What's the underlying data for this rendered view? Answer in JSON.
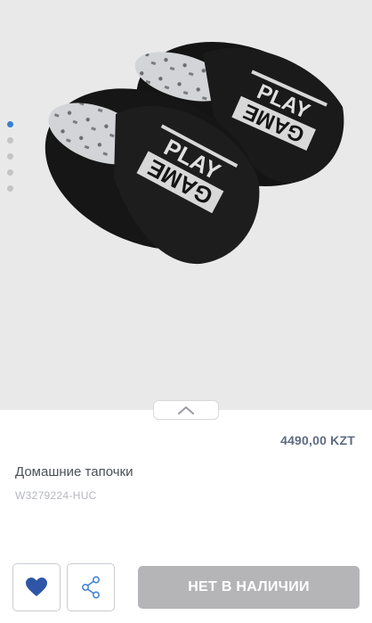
{
  "gallery": {
    "image_label": "Домашние тапочки",
    "slide_count": 5,
    "active_slide": 1,
    "print_top": "PLAY",
    "print_bottom": "GAME"
  },
  "product": {
    "price": "4490,00 KZT",
    "title": "Домашние тапочки",
    "sku": "W3279224-HUC"
  },
  "actions": {
    "stock_button_label": "НЕТ В НАЛИЧИИ"
  },
  "icons": {
    "favorite": "heart-icon",
    "share": "share-icon",
    "expand": "chevron-up-icon"
  },
  "colors": {
    "accent": "#3a7fd4",
    "price": "#5d6b82",
    "disabled_button": "#b5b5b7",
    "heart": "#2f56a6"
  }
}
